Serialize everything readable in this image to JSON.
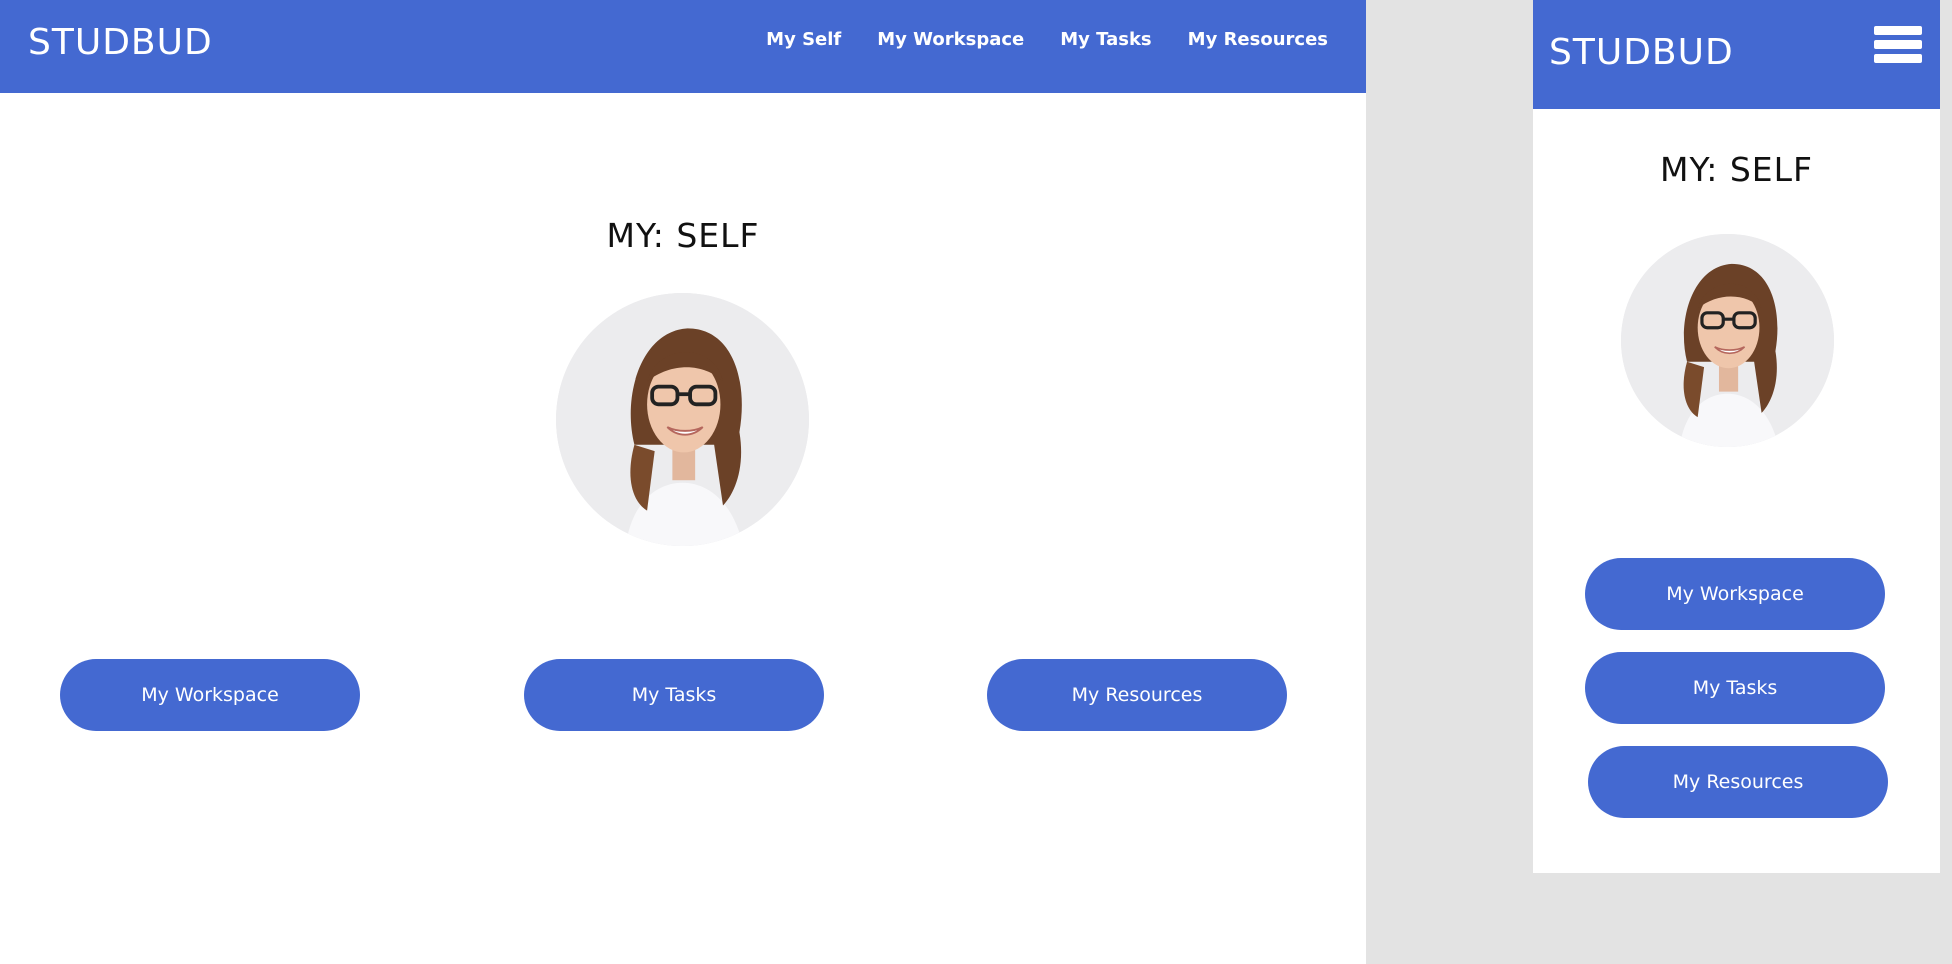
{
  "brand": {
    "logo": "STUDBUD",
    "primary_color": "#4469d1",
    "background_gray": "#e3e3e3"
  },
  "desktop": {
    "nav": [
      {
        "label": "My Self"
      },
      {
        "label": "My Workspace"
      },
      {
        "label": "My Tasks"
      },
      {
        "label": "My Resources"
      }
    ],
    "page_title": "MY: SELF",
    "buttons": [
      {
        "label": "My Workspace"
      },
      {
        "label": "My Tasks"
      },
      {
        "label": "My Resources"
      }
    ]
  },
  "mobile": {
    "menu_icon": "hamburger-menu-icon",
    "page_title": "MY: SELF",
    "buttons": [
      {
        "label": "My Workspace"
      },
      {
        "label": "My Tasks"
      },
      {
        "label": "My Resources"
      }
    ]
  }
}
